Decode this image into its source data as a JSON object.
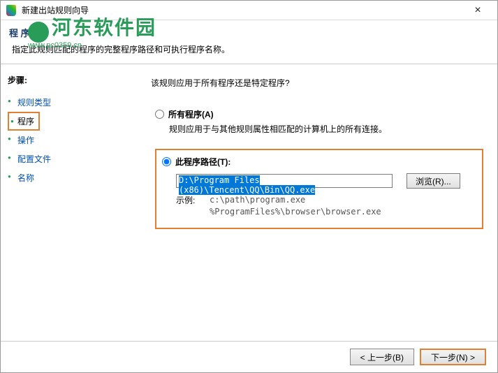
{
  "window": {
    "title": "新建出站规则向导"
  },
  "watermark": {
    "text": "河东软件园",
    "sub": "www.pc0359.cn"
  },
  "header": {
    "title": "程 序",
    "subtitle": "指定此规则匹配的程序的完整程序路径和可执行程序名称。"
  },
  "sidebar": {
    "heading": "步骤:",
    "items": [
      {
        "label": "规则类型",
        "link": true
      },
      {
        "label": "程序",
        "active": true
      },
      {
        "label": "操作",
        "link": true
      },
      {
        "label": "配置文件",
        "link": true
      },
      {
        "label": "名称",
        "link": true
      }
    ]
  },
  "content": {
    "question": "该规则应用于所有程序还是特定程序?",
    "radio_all": {
      "label": "所有程序(A)",
      "desc": "规则应用于与其他规则属性相匹配的计算机上的所有连接。"
    },
    "radio_path": {
      "label": "此程序路径(T):",
      "path_value": "D:\\Program Files (x86)\\Tencent\\QQ\\Bin\\QQ.exe",
      "browse": "浏览(R)...",
      "example_label": "示例:",
      "example_line1": "c:\\path\\program.exe",
      "example_line2": "%ProgramFiles%\\browser\\browser.exe"
    }
  },
  "footer": {
    "back": "< 上一步(B)",
    "next": "下一步(N) >"
  }
}
